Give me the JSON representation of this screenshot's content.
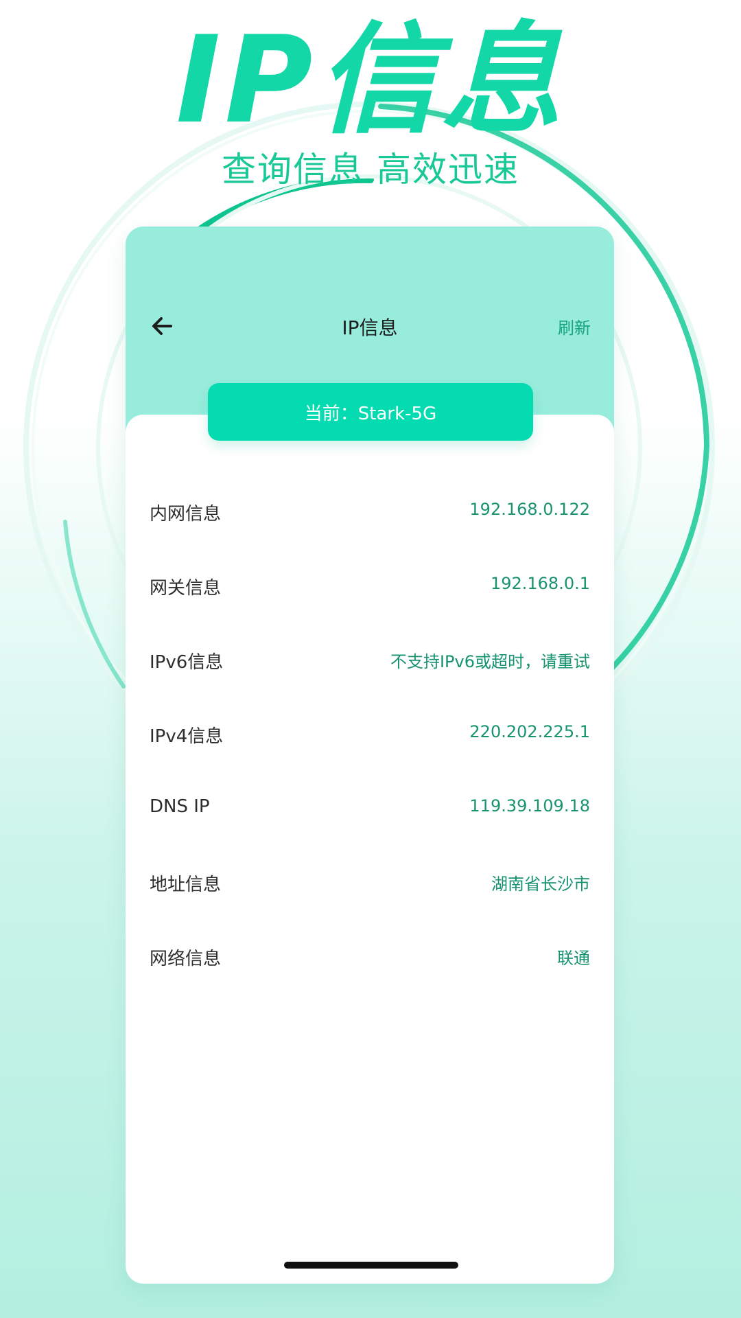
{
  "hero": {
    "title": "IP信息",
    "subtitle": "查询信息 高效迅速"
  },
  "app_bar": {
    "back_icon": "arrow-left-icon",
    "title": "IP信息",
    "refresh_label": "刷新"
  },
  "current_network": "当前：Stark-5G",
  "rows": [
    {
      "label": "内网信息",
      "value": "192.168.0.122"
    },
    {
      "label": "网关信息",
      "value": "192.168.0.1"
    },
    {
      "label": "IPv6信息",
      "value": "不支持IPv6或超时，请重试"
    },
    {
      "label": "IPv4信息",
      "value": "220.202.225.1"
    },
    {
      "label": "DNS IP",
      "value": "119.39.109.18"
    },
    {
      "label": "地址信息",
      "value": "湖南省长沙市"
    },
    {
      "label": "网络信息",
      "value": "联通"
    }
  ],
  "colors": {
    "accent": "#13d7a6",
    "pill": "#05dbb0",
    "header_bg": "#98ecdc",
    "value_text": "#18936f"
  }
}
